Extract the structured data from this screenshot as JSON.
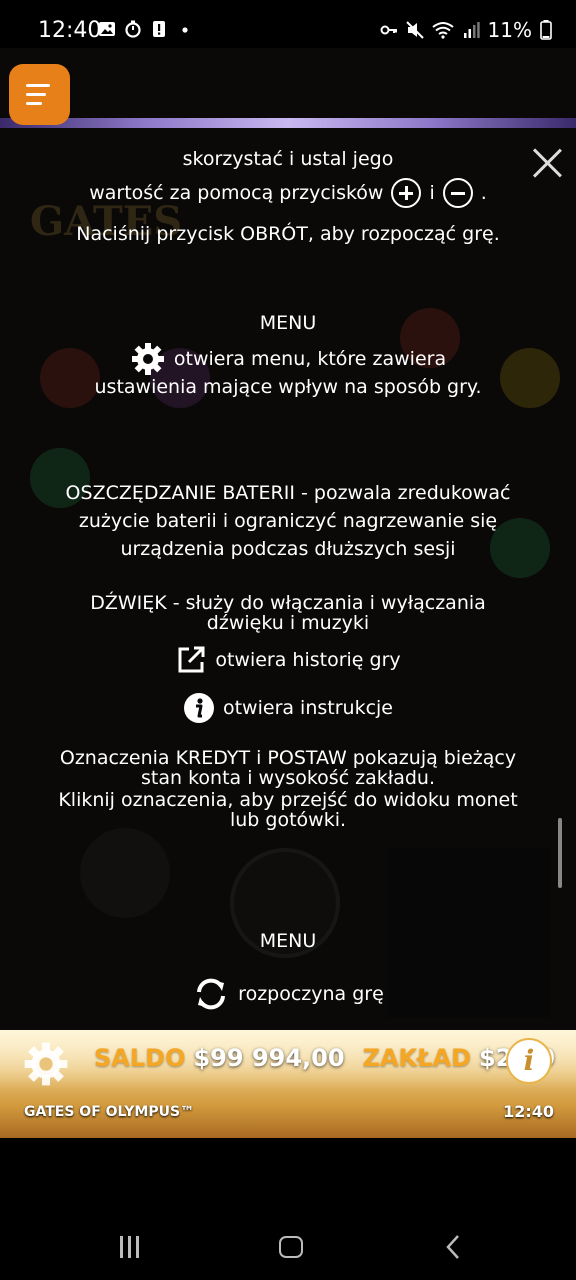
{
  "status_bar": {
    "time": "12:40",
    "battery": "11%",
    "left_icons": [
      "gallery-icon",
      "timer-icon",
      "alert-icon",
      "dot-icon"
    ],
    "right_icons": [
      "key-icon",
      "mute-icon",
      "wifi-icon",
      "signal-icon",
      "battery-icon"
    ]
  },
  "help": {
    "line1": "skorzystać i ustal jego",
    "line2_pre": "wartość za pomocą przycisków",
    "line2_mid": "i",
    "line2_end": ".",
    "line3": "Naciśnij przycisk OBRÓT, aby rozpocząć grę.",
    "menu_heading_1": "MENU",
    "menu_desc_1": "otwiera menu, które zawiera",
    "menu_desc_2": "ustawienia mające wpływ na sposób gry.",
    "battery_1": "OSZCZĘDZANIE BATERII - pozwala zredukować",
    "battery_2": "zużycie baterii i ograniczyć nagrzewanie się",
    "battery_3": "urządzenia podczas dłuższych sesji",
    "sound_1": "DŹWIĘK - służy do włączania i wyłączania",
    "sound_2": "dźwięku i muzyki",
    "history": "otwiera historię gry",
    "instructions": "otwiera instrukcje",
    "credit_1": "Oznaczenia KREDYT i POSTAW pokazują bieżący",
    "credit_2": "stan konta i wysokość zakładu.",
    "credit_3": "Kliknij oznaczenia, aby przejść do widoku monet",
    "credit_4": "lub gotówki.",
    "menu_heading_2": "MENU",
    "spin_desc": "rozpoczyna grę"
  },
  "bottom_bar": {
    "balance_label": "SALDO",
    "balance_value": "$99 994,00",
    "bet_label": "ZAKŁAD",
    "bet_value": "$2,00",
    "game_name": "GATES OF OLYMPUS™",
    "clock": "12:40",
    "info_glyph": "i"
  },
  "colors": {
    "menu_button": "#e8801a",
    "label_orange": "#f5a623",
    "panel_bg": "#0a0908"
  }
}
